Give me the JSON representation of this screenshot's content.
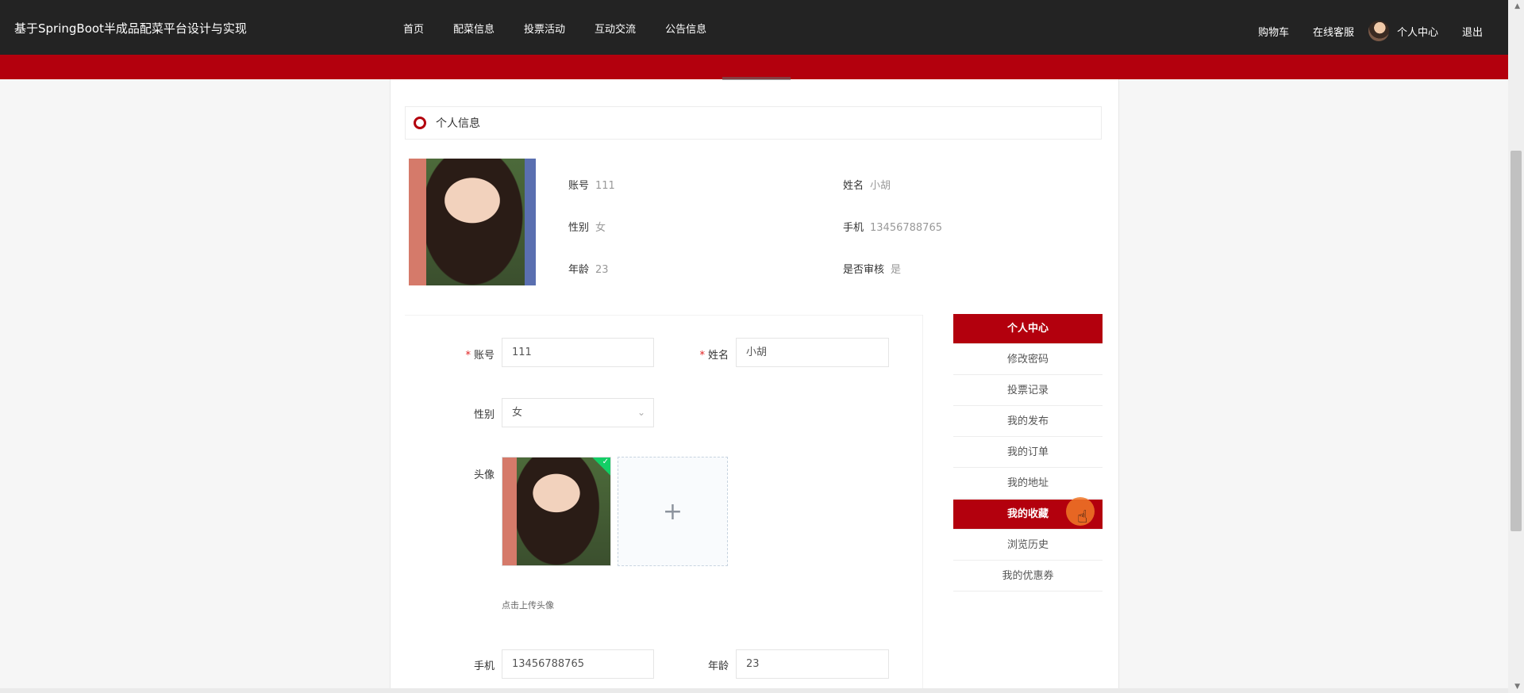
{
  "header": {
    "site_title": "基于SpringBoot半成品配菜平台设计与实现",
    "nav": [
      "首页",
      "配菜信息",
      "投票活动",
      "互动交流",
      "公告信息"
    ],
    "right": {
      "cart": "购物车",
      "service": "在线客服",
      "profile": "个人中心",
      "logout": "退出"
    }
  },
  "section": {
    "title": "个人信息"
  },
  "info": {
    "account_label": "账号",
    "account": "111",
    "name_label": "姓名",
    "name": "小胡",
    "gender_label": "性别",
    "gender": "女",
    "phone_label": "手机",
    "phone": "13456788765",
    "age_label": "年龄",
    "age": "23",
    "audit_label": "是否审核",
    "audit": "是"
  },
  "form": {
    "required_mark": "*",
    "account_label": "账号",
    "account_value": "111",
    "name_label": "姓名",
    "name_value": "小胡",
    "gender_label": "性别",
    "gender_value": "女",
    "avatar_label": "头像",
    "upload_plus": "+",
    "upload_hint": "点击上传头像",
    "phone_label": "手机",
    "phone_value": "13456788765",
    "age_label": "年龄",
    "age_value": "23"
  },
  "side_menu": [
    {
      "label": "个人中心",
      "active": true
    },
    {
      "label": "修改密码",
      "active": false
    },
    {
      "label": "投票记录",
      "active": false
    },
    {
      "label": "我的发布",
      "active": false
    },
    {
      "label": "我的订单",
      "active": false
    },
    {
      "label": "我的地址",
      "active": false
    },
    {
      "label": "我的收藏",
      "active": true
    },
    {
      "label": "浏览历史",
      "active": false
    },
    {
      "label": "我的优惠券",
      "active": false
    }
  ],
  "colors": {
    "accent": "#b3000d",
    "topbar": "#232323",
    "success": "#13ce66"
  },
  "icons": {
    "upload": "plus-icon",
    "select": "chevron-down-icon",
    "success": "check-icon",
    "pointer": "hand-cursor-icon"
  }
}
